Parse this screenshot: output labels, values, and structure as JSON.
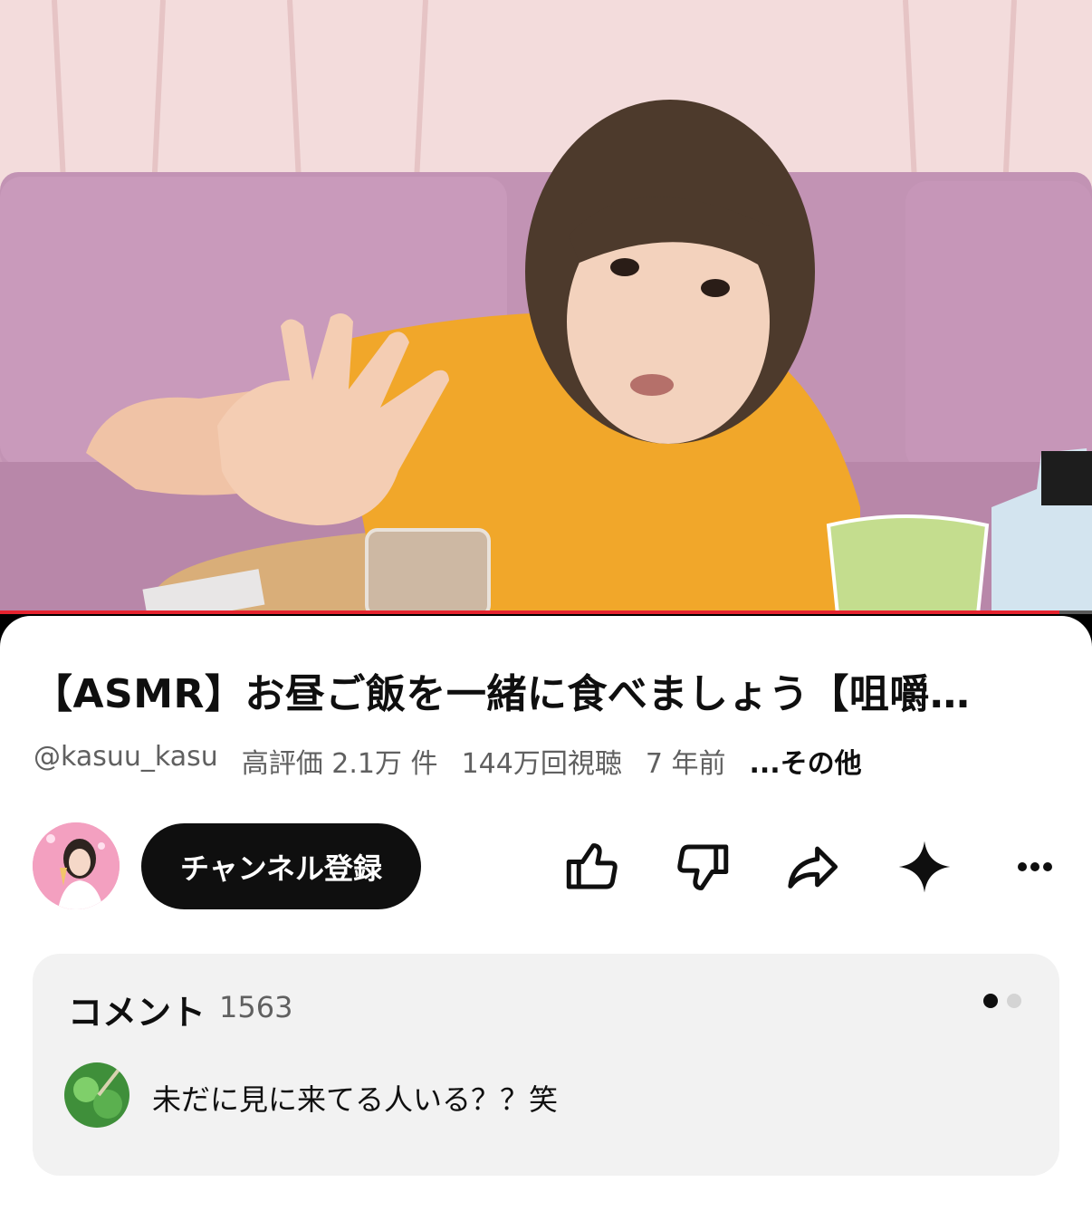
{
  "video": {
    "progress_fraction": 0.97,
    "progress_color": "#e5232f"
  },
  "title": "【ASMR】お昼ご飯を一緒に食べましょう【咀嚼…",
  "meta": {
    "channel_handle": "@kasuu_kasu",
    "likes": "高評価 2.1万 件",
    "views": "144万回視聴",
    "age": "7 年前",
    "more": "...その他"
  },
  "actions": {
    "subscribe_label": "チャンネル登録",
    "icons": [
      "like-icon",
      "dislike-icon",
      "share-icon",
      "ask-ai-sparkle-icon",
      "more-icon"
    ]
  },
  "comments": {
    "label": "コメント",
    "count": "1563",
    "top_comment": "未だに見に来てる人いる？？笑"
  },
  "colors": {
    "accent": "#e5232f",
    "text_primary": "#0f0f0f",
    "text_secondary": "#606060",
    "panel": "#f2f2f2"
  }
}
